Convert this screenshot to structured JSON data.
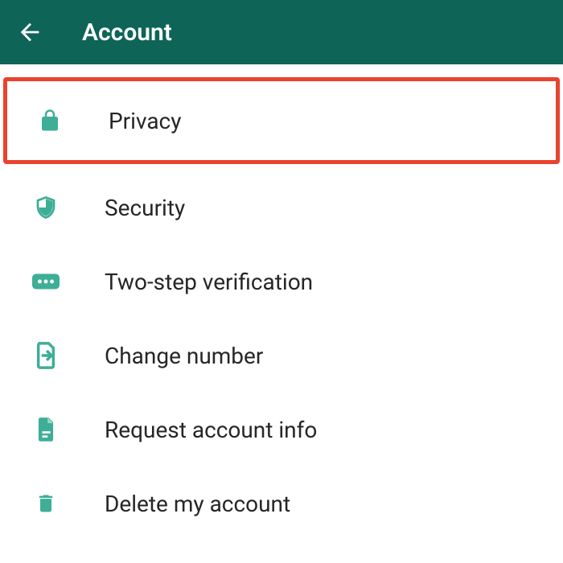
{
  "header": {
    "title": "Account"
  },
  "items": [
    {
      "label": "Privacy",
      "icon": "lock-icon",
      "highlighted": true
    },
    {
      "label": "Security",
      "icon": "shield-icon",
      "highlighted": false
    },
    {
      "label": "Two-step verification",
      "icon": "dots-icon",
      "highlighted": false
    },
    {
      "label": "Change number",
      "icon": "sim-arrow-icon",
      "highlighted": false
    },
    {
      "label": "Request account info",
      "icon": "document-icon",
      "highlighted": false
    },
    {
      "label": "Delete my account",
      "icon": "trash-icon",
      "highlighted": false
    }
  ],
  "colors": {
    "header_bg": "#0d6457",
    "icon_color": "#3eae97",
    "highlight_border": "#e8432e",
    "text": "#262626"
  }
}
